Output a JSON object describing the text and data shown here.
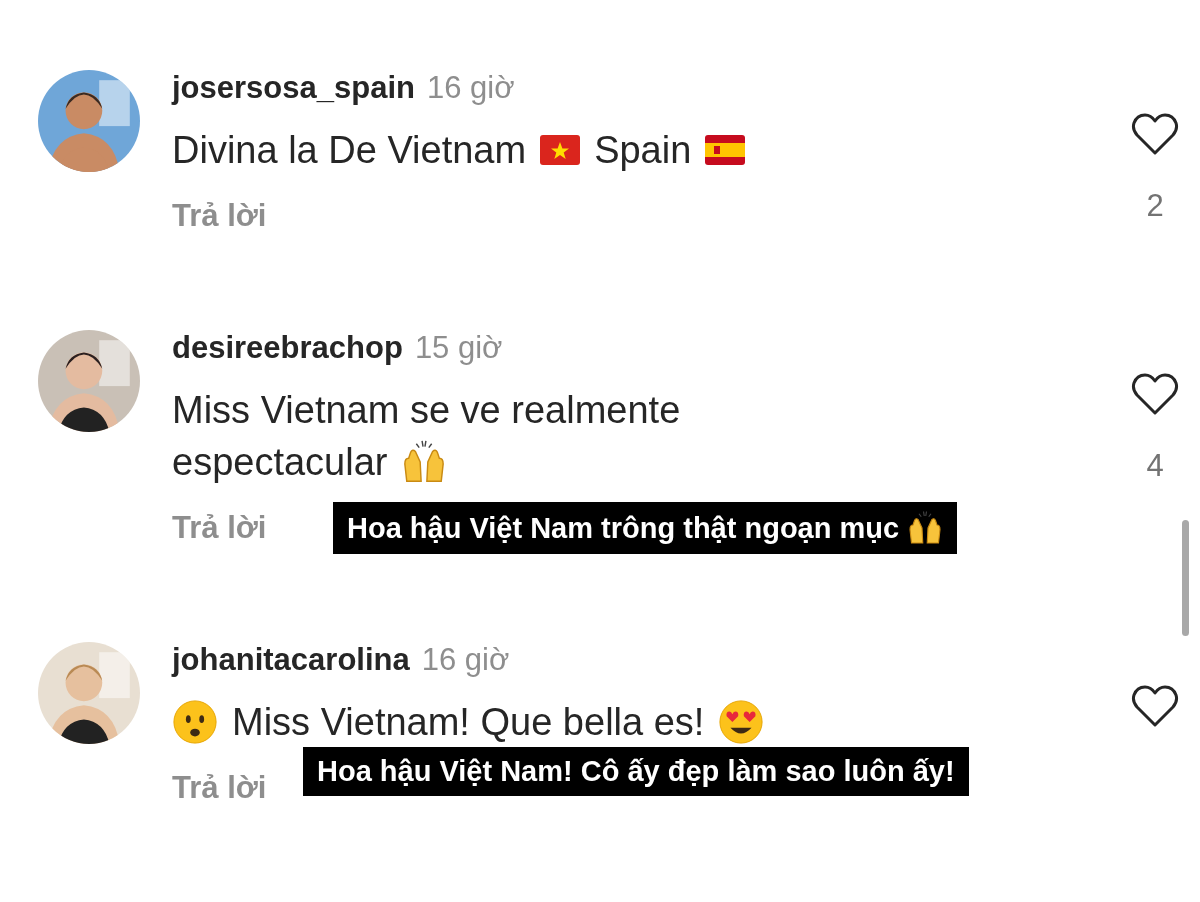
{
  "comments": [
    {
      "username": "josersosa_spain",
      "time": "16 giờ",
      "body": [
        {
          "kind": "text",
          "text": "Divina la De Vietnam"
        },
        {
          "kind": "emoji"
        },
        {
          "kind": "text",
          "text": "Spain"
        },
        {
          "kind": "emoji"
        }
      ],
      "reply": "Trả lời",
      "likes": "2"
    },
    {
      "username": "desireebrachop",
      "time": "15 giờ",
      "body": [
        {
          "kind": "text",
          "text": "Miss Vietnam se ve realmente"
        },
        {
          "kind": "text",
          "text": "espectacular"
        },
        {
          "kind": "emoji"
        }
      ],
      "reply": "Trả lời",
      "likes": "4",
      "caption": [
        {
          "kind": "text",
          "text": "Hoa hậu Việt Nam trông thật ngoạn mục"
        },
        {
          "kind": "emoji"
        }
      ]
    },
    {
      "username": "johanitacarolina",
      "time": "16 giờ",
      "body": [
        {
          "kind": "emoji"
        },
        {
          "kind": "text",
          "text": "Miss Vietnam! Que bella es!"
        },
        {
          "kind": "emoji"
        }
      ],
      "reply": "Trả lời",
      "caption": [
        {
          "kind": "text",
          "text": "Hoa hậu Việt Nam! Cô ấy đẹp làm sao luôn ấy!"
        }
      ]
    }
  ]
}
